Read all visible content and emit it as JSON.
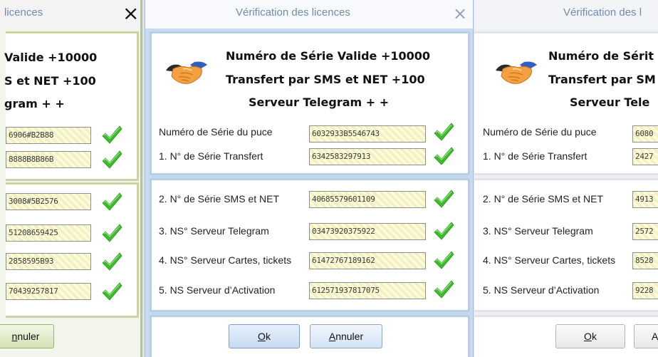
{
  "left_window": {
    "title": "licences",
    "heading": {
      "line1": "Valide  +10000",
      "line2": "S et NET  +100",
      "line3": "gram  + +"
    },
    "serials": [
      "6906#B2B88",
      "8888B8B86B",
      "3008#5B2576",
      "51208659425",
      "2858595B93",
      "70439257817"
    ],
    "cancel_mnemonic": "n",
    "cancel_rest": "nuler"
  },
  "center_window": {
    "title": "Vérification des licences",
    "heading": {
      "line1": "Numéro de Série Valide  +10000",
      "line2": "Transfert par SMS et NET   +100",
      "line3": "Serveur Telegram  + +"
    },
    "rows_top": [
      {
        "label": "Numéro de Série du puce",
        "serial": "6032933B5546743"
      },
      {
        "label": "1. N° de Série Transfert",
        "serial": "6342583297913"
      }
    ],
    "rows_bottom": [
      {
        "label": "2. N° de Série SMS et NET",
        "serial": "40685579601109"
      },
      {
        "label": "3. NS° Serveur Telegram",
        "serial": "03473920375922"
      },
      {
        "label": "4. NS° Serveur Cartes, tickets",
        "serial": "61472767189162"
      },
      {
        "label": "5. NS Serveur d’Activation",
        "serial": "612571937817075"
      }
    ],
    "ok": {
      "mnemonic": "O",
      "rest": "k"
    },
    "cancel": {
      "mnemonic": "A",
      "rest": "nnuler"
    }
  },
  "right_window": {
    "title": "Vérification des l",
    "heading": {
      "line1": "Numéro de Sérit",
      "line2": "Transfert par SM",
      "line3": "Serveur Tele"
    },
    "rows_top": [
      {
        "label": "Numéro de Série du puce",
        "serial": "6080"
      },
      {
        "label": "1. N° de Série Transfert",
        "serial": "2427"
      }
    ],
    "rows_bottom": [
      {
        "label": "2. N° de Série SMS et NET",
        "serial": "4913"
      },
      {
        "label": "3. NS° Serveur Telegram",
        "serial": "2572"
      },
      {
        "label": "4. NS° Serveur Cartes, tickets",
        "serial": "8528"
      },
      {
        "label": "5. NS Serveur d’Activation",
        "serial": "9228"
      }
    ],
    "ok": {
      "mnemonic": "O",
      "rest": "k"
    },
    "cancel_visible": "A"
  },
  "close_glyph": "×",
  "colors": {
    "check": "#3dbb2b",
    "title": "#6f8bb0",
    "serial_bg": "#ffffcf",
    "panel_border_blue": "#b7cfe9"
  }
}
